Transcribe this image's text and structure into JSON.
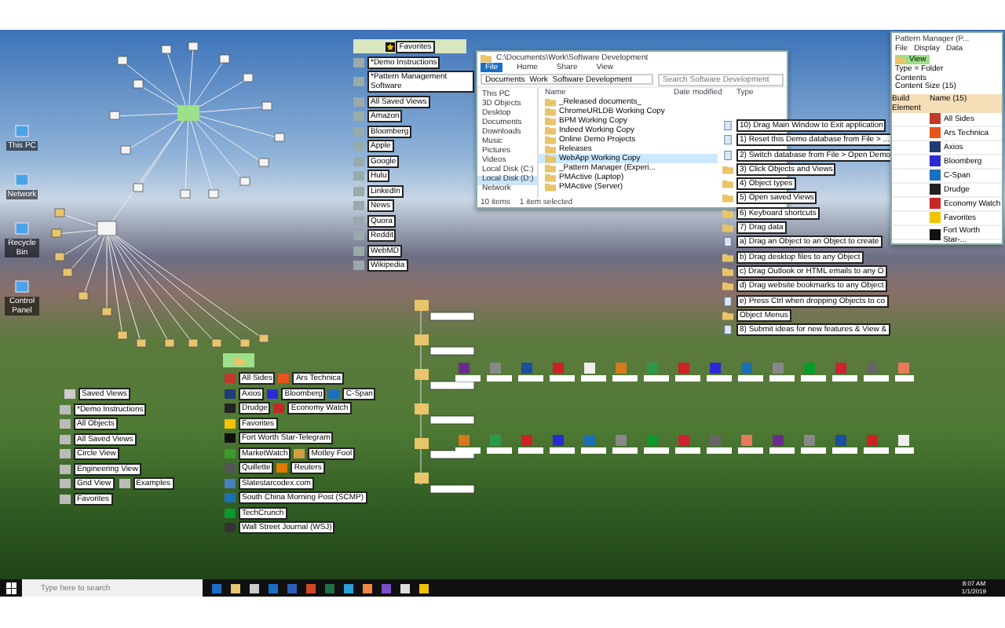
{
  "desktop_icons": [
    {
      "label": "This PC"
    },
    {
      "label": "Network"
    },
    {
      "label": "Recycle Bin"
    },
    {
      "label": "Control Panel"
    }
  ],
  "favorites_panel": {
    "title": "Favorites",
    "items": [
      "*Demo Instructions",
      "*Pattern Management Software",
      "All Saved Views",
      "Amazon",
      "Bloomberg",
      "Apple",
      "Google",
      "Hulu",
      "LinkedIn",
      "News",
      "Quora",
      "Reddit",
      "WebMD",
      "Wikipedia"
    ]
  },
  "explorer": {
    "title": "C:\\Documents\\Work\\Software Development",
    "tabs": [
      {
        "label": "File",
        "selected": true
      },
      {
        "label": "Home",
        "selected": false
      },
      {
        "label": "Share",
        "selected": false
      },
      {
        "label": "View",
        "selected": false
      }
    ],
    "path": [
      "Documents",
      "Work",
      "Software Development"
    ],
    "search": {
      "placeholder": "Search Software Development"
    },
    "nav": [
      {
        "label": "This PC",
        "selected": false
      },
      {
        "label": "3D Objects",
        "selected": false
      },
      {
        "label": "Desktop",
        "selected": false
      },
      {
        "label": "Documents",
        "selected": false
      },
      {
        "label": "Downloads",
        "selected": false
      },
      {
        "label": "Music",
        "selected": false
      },
      {
        "label": "Pictures",
        "selected": false
      },
      {
        "label": "Videos",
        "selected": false
      },
      {
        "label": "Local Disk (C:)",
        "selected": false
      },
      {
        "label": "Local Disk (D:)",
        "selected": true
      },
      {
        "label": "Network",
        "selected": false
      }
    ],
    "columns": [
      "Name",
      "Date modified",
      "Type"
    ],
    "rows": [
      {
        "name": "_Released documents_",
        "selected": false
      },
      {
        "name": "ChromeURLDB Working Copy",
        "selected": false
      },
      {
        "name": "BPM Working Copy",
        "selected": false
      },
      {
        "name": "Indeed Working Copy",
        "selected": false
      },
      {
        "name": "Online Demo Projects",
        "selected": false
      },
      {
        "name": "Releases",
        "selected": false
      },
      {
        "name": "WebApp Working Copy",
        "selected": true
      },
      {
        "name": "_Pattern Manager (Experi...",
        "selected": false
      },
      {
        "name": "PMActive (Laptop)",
        "selected": false
      },
      {
        "name": "PMActive (Server)",
        "selected": false
      }
    ],
    "status": [
      "10 items",
      "1 item selected"
    ]
  },
  "demo_list": [
    {
      "label": "10) Drag Main Window to Exit application",
      "kind": "doc"
    },
    {
      "label": "1) Reset this Demo database from File > ...",
      "kind": "doc"
    },
    {
      "label": "2) Switch database from File > Open Demo",
      "kind": "doc"
    },
    {
      "label": "3) Click Objects and Views",
      "kind": "folder"
    },
    {
      "label": "4) Object types",
      "kind": "folder"
    },
    {
      "label": "5) Open saved Views",
      "kind": "folder"
    },
    {
      "label": "6) Keyboard shortcuts",
      "kind": "folder"
    },
    {
      "label": "7) Drag data",
      "kind": "folder"
    },
    {
      "label": "a) Drag an Object to an Object to create",
      "kind": "doc"
    },
    {
      "label": "b) Drag desktop files to any Object",
      "kind": "folder"
    },
    {
      "label": "c) Drag Outlook or HTML emails to any O",
      "kind": "folder"
    },
    {
      "label": "d) Drag website bookmarks to any Object",
      "kind": "folder"
    },
    {
      "label": "e) Press Ctrl when dropping Objects to co",
      "kind": "doc"
    },
    {
      "label": "Object Menus",
      "kind": "folder"
    },
    {
      "label": "8) Submit ideas for new features & View &",
      "kind": "doc"
    }
  ],
  "pattern_manager": {
    "title": "Pattern Manager (P...",
    "menu": [
      "File",
      "Display",
      "Data"
    ],
    "selected_object": "View",
    "details": [
      "Type = Folder",
      "Contents",
      "Content Size (15)"
    ],
    "columns": [
      "Build Element",
      "Name (15)"
    ],
    "rows": [
      {
        "name": "All Sides",
        "color": "#c0392b"
      },
      {
        "name": "Ars Technica",
        "color": "#e8541c"
      },
      {
        "name": "Axios",
        "color": "#1f3b73"
      },
      {
        "name": "Bloomberg",
        "color": "#2b2bd6"
      },
      {
        "name": "C-Span",
        "color": "#1b6fc2"
      },
      {
        "name": "Drudge",
        "color": "#222222"
      },
      {
        "name": "Economy Watch",
        "color": "#c62828"
      },
      {
        "name": "Favorites",
        "color": "#f2c300"
      },
      {
        "name": "Fort Worth Star-...",
        "color": "#111111"
      }
    ]
  },
  "news_panel": {
    "items": [
      {
        "label": "All Sides",
        "color": "#c0392b"
      },
      {
        "label": "Ars Technica",
        "color": "#e8541c"
      },
      {
        "label": "Axios",
        "color": "#1f3b73"
      },
      {
        "label": "Bloomberg",
        "color": "#2b2bd6"
      },
      {
        "label": "C-Span",
        "color": "#1b6fc2"
      },
      {
        "label": "Drudge",
        "color": "#222222"
      },
      {
        "label": "Economy Watch",
        "color": "#c62828"
      },
      {
        "label": "Favorites",
        "color": "#f2c300"
      },
      {
        "label": "Fort Worth Star-Telegram",
        "color": "#111111"
      },
      {
        "label": "MarketWatch",
        "color": "#3a9a2a"
      },
      {
        "label": "Motley Fool",
        "color": "#d2a040"
      },
      {
        "label": "Quillette",
        "color": "#555555"
      },
      {
        "label": "Reuters",
        "color": "#e07b00"
      },
      {
        "label": "Slatestarcodex.com",
        "color": "#4a7fc0"
      },
      {
        "label": "South China Morning Post (SCMP)",
        "color": "#1a6fb5"
      },
      {
        "label": "TechCrunch",
        "color": "#0a9a2a"
      },
      {
        "label": "Wall Street Journal (WSJ)",
        "color": "#333333"
      }
    ]
  },
  "saved_views": {
    "title": "Saved Views",
    "items": [
      "*Demo Instructions",
      "All Objects",
      "All Saved Views",
      "Circle View",
      "Engineering View",
      "Grid View",
      "Examples",
      "Favorites"
    ]
  },
  "taskbar": {
    "search": {
      "placeholder": "Type here to search"
    },
    "time": "8:07 AM",
    "date": "1/1/2019"
  }
}
